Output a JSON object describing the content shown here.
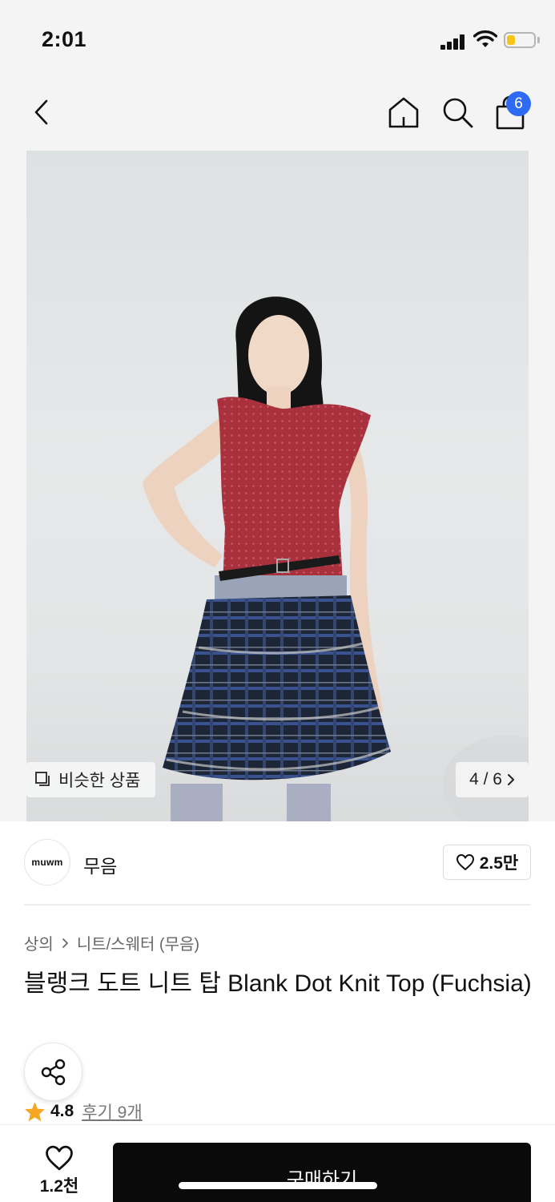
{
  "status_bar": {
    "time": "2:01",
    "battery_level": 0.3,
    "battery_color": "#f5c518"
  },
  "nav": {
    "back_icon": "chevron-left-icon",
    "home_icon": "home-icon",
    "search_icon": "search-icon",
    "cart_icon": "shopping-bag-icon",
    "cart_badge": "6",
    "badge_color": "#2f6af2"
  },
  "gallery": {
    "similar_label": "비슷한 상품",
    "page_indicator": "4 / 6"
  },
  "brand": {
    "logo_text": "muwm",
    "name": "무음",
    "likes": "2.5만"
  },
  "breadcrumb": {
    "category": "상의",
    "subcategory": "니트/스웨터 (무음)"
  },
  "product": {
    "title": "블랭크 도트 니트 탑 Blank Dot Knit Top (Fuchsia)"
  },
  "rating": {
    "score": "4.8",
    "reviews": "후기 9개",
    "star_color": "#f5a623"
  },
  "bottom_bar": {
    "wish_count": "1.2천",
    "buy_label": "구매하기"
  }
}
